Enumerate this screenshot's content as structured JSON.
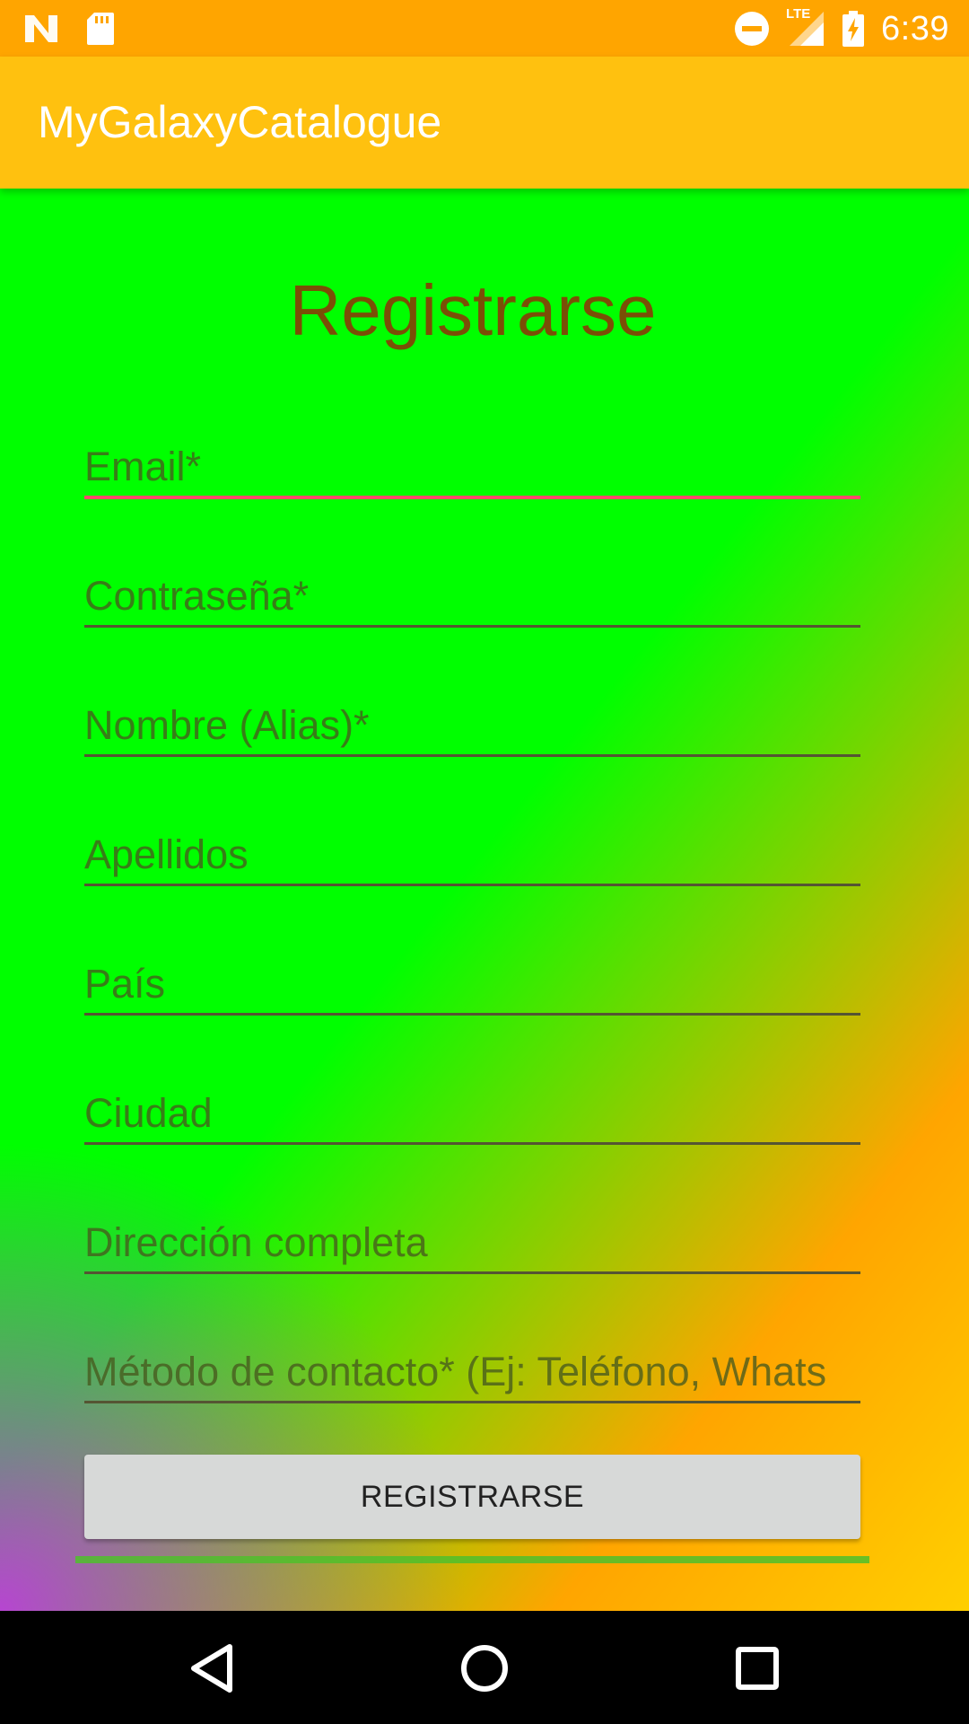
{
  "status_bar": {
    "time": "6:39",
    "network_label": "LTE",
    "icons": [
      "n-logo-icon",
      "sd-card-icon",
      "do-not-disturb-icon",
      "signal-icon",
      "battery-charging-icon"
    ]
  },
  "app_bar": {
    "title": "MyGalaxyCatalogue"
  },
  "form": {
    "title": "Registrarse",
    "fields": [
      {
        "placeholder": "Email*",
        "value": ""
      },
      {
        "placeholder": "Contraseña*",
        "value": ""
      },
      {
        "placeholder": "Nombre (Alias)*",
        "value": ""
      },
      {
        "placeholder": "Apellidos",
        "value": ""
      },
      {
        "placeholder": "País",
        "value": ""
      },
      {
        "placeholder": "Ciudad",
        "value": ""
      },
      {
        "placeholder": "Dirección completa",
        "value": ""
      },
      {
        "placeholder": "Método de contacto* (Ej: Teléfono, Whats",
        "value": ""
      }
    ],
    "submit_label": "REGISTRARSE"
  },
  "colors": {
    "status_bar": "#ffa500",
    "app_bar": "#ffc10f",
    "title_text": "#7a4f06",
    "focus_underline": "#ff4a6a",
    "button_bg": "#d7d9d8"
  },
  "nav_bar": {
    "icons": [
      "back-icon",
      "home-icon",
      "recents-icon"
    ]
  }
}
